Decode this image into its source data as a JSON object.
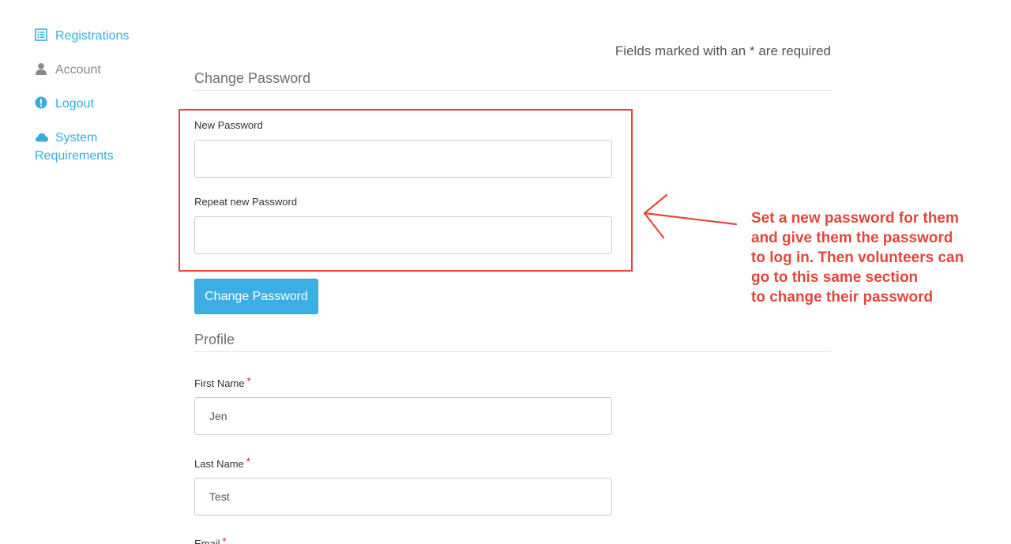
{
  "sidebar": {
    "items": [
      {
        "label": "Registrations",
        "icon": "list-icon"
      },
      {
        "label": "Account",
        "icon": "user-icon"
      },
      {
        "label": "Logout",
        "icon": "alert-circle-icon"
      },
      {
        "label_line1": "System",
        "label_line2": "Requirements",
        "icon": "cloud-icon"
      }
    ]
  },
  "header": {
    "required_note": "Fields marked with an * are required"
  },
  "change_password": {
    "title": "Change Password",
    "new_password_label": "New Password",
    "new_password_value": "",
    "repeat_password_label": "Repeat new Password",
    "repeat_password_value": "",
    "submit_label": "Change Password"
  },
  "profile": {
    "title": "Profile",
    "required_marker": "*",
    "first_name_label": "First Name",
    "first_name_value": "Jen",
    "last_name_label": "Last Name",
    "last_name_value": "Test",
    "email_label": "Email"
  },
  "annotation": {
    "lines": [
      "Set a new password for them",
      "and give them the password",
      "to log in. Then volunteers can",
      "go to this same section",
      "to change their password"
    ]
  },
  "colors": {
    "link_blue": "#36aee0",
    "button_blue": "#3daee3",
    "annotation_red": "#e2473a",
    "required_red": "#c0141b"
  }
}
